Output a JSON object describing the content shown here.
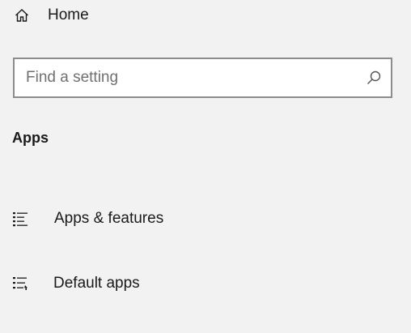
{
  "nav": {
    "home": {
      "label": "Home",
      "icon": "home-icon"
    }
  },
  "search": {
    "placeholder": "Find a setting",
    "value": "",
    "icon": "search-icon"
  },
  "section": {
    "title": "Apps",
    "items": [
      {
        "label": "Apps & features",
        "icon": "apps-features-icon"
      },
      {
        "label": "Default apps",
        "icon": "default-apps-icon"
      }
    ]
  },
  "colors": {
    "background": "#f2f2f2",
    "text": "#1a1a1a",
    "search_border": "#8c8c8c",
    "placeholder": "#707070"
  }
}
